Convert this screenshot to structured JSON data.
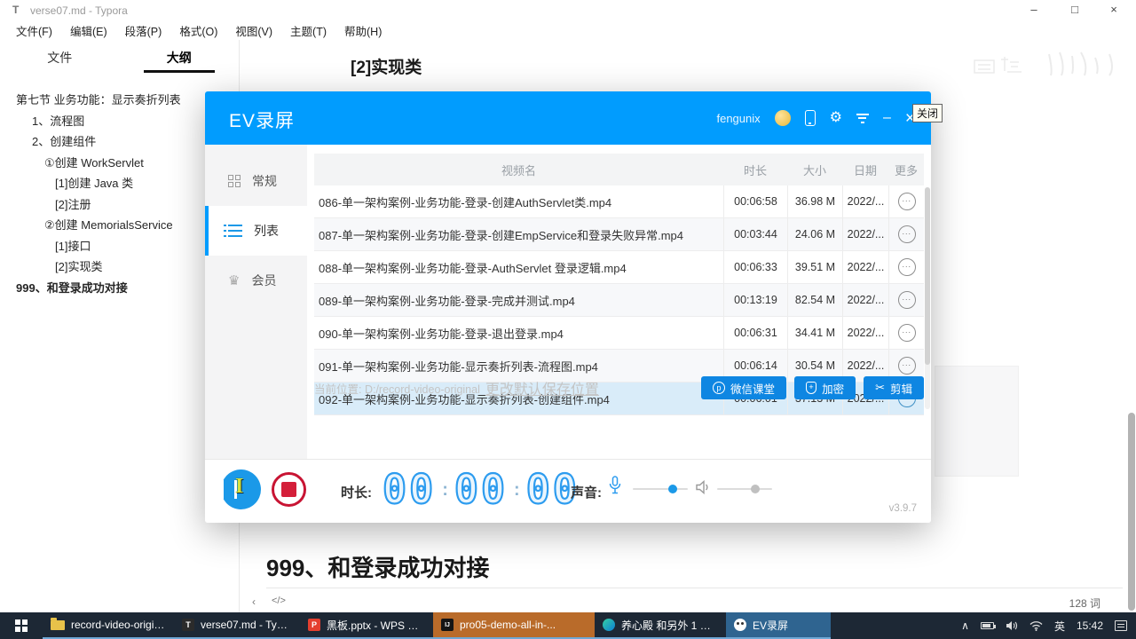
{
  "colors": {
    "ev_titlebar_blue": "#019cfe",
    "ev_button_blue": "#0e86e2",
    "selected_row_blue": "#d9ecf9",
    "record_button_blue": "#1b99e8",
    "stop_button_red": "#c81433",
    "taskbar_bg": "#1d2835",
    "idea_task_orange": "#b96b2a",
    "ev_task_blue": "#2f6490",
    "clock_digit_blue": "#2d9cef"
  },
  "icons": {
    "minimize": "–",
    "maximize": "□",
    "close": "×",
    "gear": "⚙",
    "more": "···",
    "scissors": "✂",
    "vip": "♛",
    "chevron_up": "∧",
    "back": "‹",
    "code": "</>",
    "wechat_p": "p",
    "shield_plus": "+",
    "app_letter_typora": "T",
    "app_letter_wps": "P",
    "app_letter_idea": "IJ"
  },
  "typora": {
    "window_icon": "T",
    "title": "verse07.md - Typora",
    "menu": [
      "文件(F)",
      "编辑(E)",
      "段落(P)",
      "格式(O)",
      "视图(V)",
      "主题(T)",
      "帮助(H)"
    ],
    "sidebar": {
      "tabs": [
        {
          "label": "文件"
        },
        {
          "label": "大纲"
        }
      ],
      "outline": [
        {
          "label": "第七节 业务功能：显示奏折列表"
        },
        {
          "label": "1、流程图"
        },
        {
          "label": "2、创建组件"
        },
        {
          "label": "①创建 WorkServlet"
        },
        {
          "label": "[1]创建 Java 类"
        },
        {
          "label": "[2]注册"
        },
        {
          "label": "②创建 MemorialsService"
        },
        {
          "label": "[1]接口"
        },
        {
          "label": "[2]实现类"
        },
        {
          "label": "999、和登录成功对接"
        }
      ]
    },
    "document": {
      "heading_top": "[2]实现类",
      "heading_bottom": "999、和登录成功对接",
      "word_count": "128 词"
    }
  },
  "ev": {
    "title": "EV录屏",
    "username": "fengunix",
    "tooltip_close": "关闭",
    "nav": [
      {
        "label": "常规"
      },
      {
        "label": "列表"
      },
      {
        "label": "会员"
      }
    ],
    "table": {
      "headers": [
        "视频名",
        "时长",
        "大小",
        "日期",
        "更多"
      ],
      "rows": [
        {
          "name": "086-单一架构案例-业务功能-登录-创建AuthServlet类.mp4",
          "duration": "00:06:58",
          "size": "36.98 M",
          "date": "2022/..."
        },
        {
          "name": "087-单一架构案例-业务功能-登录-创建EmpService和登录失败异常.mp4",
          "duration": "00:03:44",
          "size": "24.06 M",
          "date": "2022/..."
        },
        {
          "name": "088-单一架构案例-业务功能-登录-AuthServlet 登录逻辑.mp4",
          "duration": "00:06:33",
          "size": "39.51 M",
          "date": "2022/..."
        },
        {
          "name": "089-单一架构案例-业务功能-登录-完成并测试.mp4",
          "duration": "00:13:19",
          "size": "82.54 M",
          "date": "2022/..."
        },
        {
          "name": "090-单一架构案例-业务功能-登录-退出登录.mp4",
          "duration": "00:06:31",
          "size": "34.41 M",
          "date": "2022/..."
        },
        {
          "name": "091-单一架构案例-业务功能-显示奏折列表-流程图.mp4",
          "duration": "00:06:14",
          "size": "30.54 M",
          "date": "2022/..."
        },
        {
          "name": "092-单一架构案例-业务功能-显示奏折列表-创建组件.mp4",
          "duration": "00:06:01",
          "size": "37.13 M",
          "date": "2022/..."
        }
      ]
    },
    "footer": {
      "location_label": "当前位置: D:/record-video-original",
      "change_link": "更改默认保存位置",
      "buttons": {
        "wechat_class": "微信课堂",
        "encrypt": "加密",
        "clip": "剪辑"
      }
    },
    "controls": {
      "duration_label": "时长:",
      "time_hh": "00",
      "time_mm": "00",
      "time_ss": "00",
      "colon": ":",
      "sound_label": "声音:",
      "version": "v3.9.7"
    }
  },
  "taskbar": {
    "tasks": [
      {
        "label": "record-video-origin..."
      },
      {
        "label": "verse07.md - Typora"
      },
      {
        "label": "黑板.pptx - WPS Off..."
      },
      {
        "label": "pro05-demo-all-in-..."
      },
      {
        "label": "养心殿 和另外 1 个页..."
      },
      {
        "label": "EV录屏"
      }
    ],
    "tray": {
      "ime": "英",
      "time": "15:42"
    }
  }
}
